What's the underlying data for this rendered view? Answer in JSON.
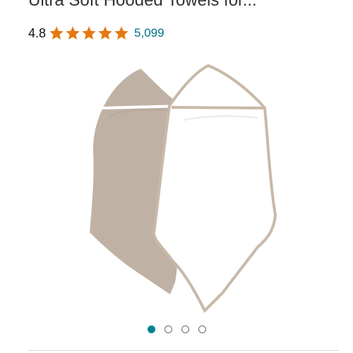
{
  "product": {
    "title": "Ultra Soft Hooded Towels for..."
  },
  "rating": {
    "value": "4.8",
    "stars_filled": 5,
    "review_count": "5,099",
    "star_color": "#e47911",
    "link_color": "#007185"
  },
  "carousel": {
    "total": 4,
    "active_index": 0,
    "active_color": "#00838f"
  },
  "image": {
    "towel_colors": [
      "#bfb2a4",
      "#ffffff"
    ],
    "trim_color": "#c8b9a8"
  }
}
